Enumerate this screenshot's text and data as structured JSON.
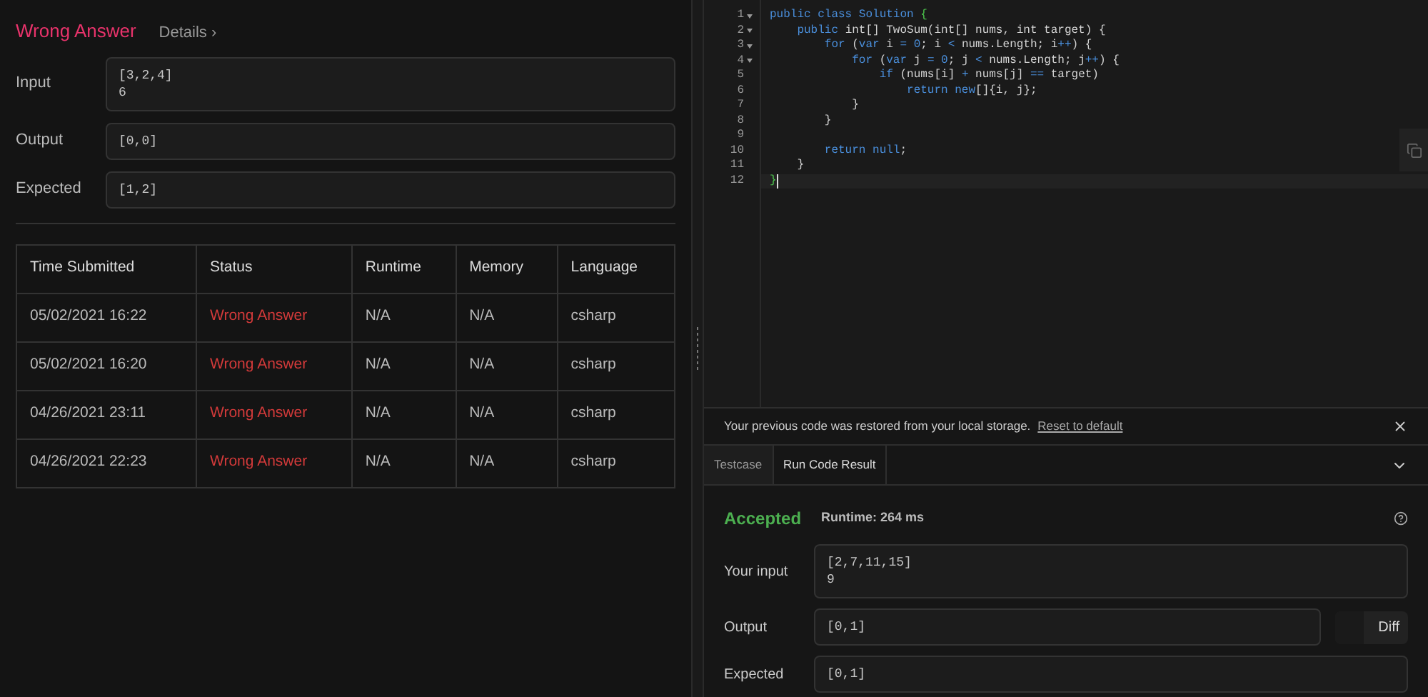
{
  "result": {
    "verdict": "Wrong Answer",
    "details_link": "Details ›",
    "fields": [
      {
        "label": "Input",
        "lines": [
          "[3,2,4]",
          "6"
        ]
      },
      {
        "label": "Output",
        "lines": [
          "[0,0]"
        ]
      },
      {
        "label": "Expected",
        "lines": [
          "[1,2]"
        ]
      }
    ]
  },
  "submissions": {
    "columns": [
      "Time Submitted",
      "Status",
      "Runtime",
      "Memory",
      "Language"
    ],
    "rows": [
      {
        "time": "05/02/2021 16:22",
        "status": "Wrong Answer",
        "runtime": "N/A",
        "memory": "N/A",
        "language": "csharp"
      },
      {
        "time": "05/02/2021 16:20",
        "status": "Wrong Answer",
        "runtime": "N/A",
        "memory": "N/A",
        "language": "csharp"
      },
      {
        "time": "04/26/2021 23:11",
        "status": "Wrong Answer",
        "runtime": "N/A",
        "memory": "N/A",
        "language": "csharp"
      },
      {
        "time": "04/26/2021 22:23",
        "status": "Wrong Answer",
        "runtime": "N/A",
        "memory": "N/A",
        "language": "csharp"
      }
    ]
  },
  "editor": {
    "lines": [
      {
        "number": "1",
        "foldable": true,
        "active": false,
        "tokens": [
          {
            "text": "public class Solution ",
            "kind": "keyword"
          },
          {
            "text": "{",
            "kind": "bracket"
          }
        ]
      },
      {
        "number": "2",
        "foldable": true,
        "active": false,
        "tokens": [
          {
            "text": "    public",
            "kind": "keyword"
          },
          {
            "text": " int[] TwoSum(int[] nums, int target) {",
            "kind": "plain"
          }
        ]
      },
      {
        "number": "3",
        "foldable": true,
        "active": false,
        "tokens": [
          {
            "text": "        for",
            "kind": "keyword"
          },
          {
            "text": " (",
            "kind": "plain"
          },
          {
            "text": "var",
            "kind": "keyword"
          },
          {
            "text": " i ",
            "kind": "plain"
          },
          {
            "text": "= 0",
            "kind": "keyword"
          },
          {
            "text": "; i ",
            "kind": "plain"
          },
          {
            "text": "<",
            "kind": "keyword"
          },
          {
            "text": " nums.Length; i",
            "kind": "plain"
          },
          {
            "text": "++",
            "kind": "keyword"
          },
          {
            "text": ") {",
            "kind": "plain"
          }
        ]
      },
      {
        "number": "4",
        "foldable": true,
        "active": false,
        "tokens": [
          {
            "text": "            for",
            "kind": "keyword"
          },
          {
            "text": " (",
            "kind": "plain"
          },
          {
            "text": "var",
            "kind": "keyword"
          },
          {
            "text": " j ",
            "kind": "plain"
          },
          {
            "text": "= 0",
            "kind": "keyword"
          },
          {
            "text": "; j ",
            "kind": "plain"
          },
          {
            "text": "<",
            "kind": "keyword"
          },
          {
            "text": " nums.Length; j",
            "kind": "plain"
          },
          {
            "text": "++",
            "kind": "keyword"
          },
          {
            "text": ") {",
            "kind": "plain"
          }
        ]
      },
      {
        "number": "5",
        "foldable": false,
        "active": false,
        "tokens": [
          {
            "text": "                if",
            "kind": "keyword"
          },
          {
            "text": " (nums[i] ",
            "kind": "plain"
          },
          {
            "text": "+",
            "kind": "keyword"
          },
          {
            "text": " nums[j] ",
            "kind": "plain"
          },
          {
            "text": "==",
            "kind": "keyword"
          },
          {
            "text": " target)",
            "kind": "plain"
          }
        ]
      },
      {
        "number": "6",
        "foldable": false,
        "active": false,
        "tokens": [
          {
            "text": "                    return new",
            "kind": "keyword"
          },
          {
            "text": "[]{i, j};",
            "kind": "plain"
          }
        ]
      },
      {
        "number": "7",
        "foldable": false,
        "active": false,
        "tokens": [
          {
            "text": "            }",
            "kind": "plain"
          }
        ]
      },
      {
        "number": "8",
        "foldable": false,
        "active": false,
        "tokens": [
          {
            "text": "        }",
            "kind": "plain"
          }
        ]
      },
      {
        "number": "9",
        "foldable": false,
        "active": false
      },
      {
        "number": "10",
        "foldable": false,
        "active": false,
        "tokens": [
          {
            "text": "        return null",
            "kind": "keyword"
          },
          {
            "text": ";",
            "kind": "plain"
          }
        ]
      },
      {
        "number": "11",
        "foldable": false,
        "active": false,
        "tokens": [
          {
            "text": "    }",
            "kind": "plain"
          }
        ]
      },
      {
        "number": "12",
        "foldable": false,
        "active": true,
        "tokens": [
          {
            "text": "}",
            "kind": "bracket"
          }
        ]
      }
    ]
  },
  "notice": {
    "message": "Your previous code was restored from your local storage.",
    "link": "Reset to default"
  },
  "tabs": [
    {
      "label": "Testcase",
      "selected": false
    },
    {
      "label": "Run Code Result",
      "selected": true
    }
  ],
  "run_result": {
    "verdict": "Accepted",
    "runtime": "Runtime: 264 ms",
    "fields": [
      {
        "label": "Your input",
        "lines": [
          "[2,7,11,15]",
          "9"
        ]
      },
      {
        "label": "Output",
        "lines": [
          "[0,1]"
        ]
      },
      {
        "label": "Expected",
        "lines": [
          "[0,1]"
        ]
      }
    ],
    "diff_button": "Diff"
  }
}
